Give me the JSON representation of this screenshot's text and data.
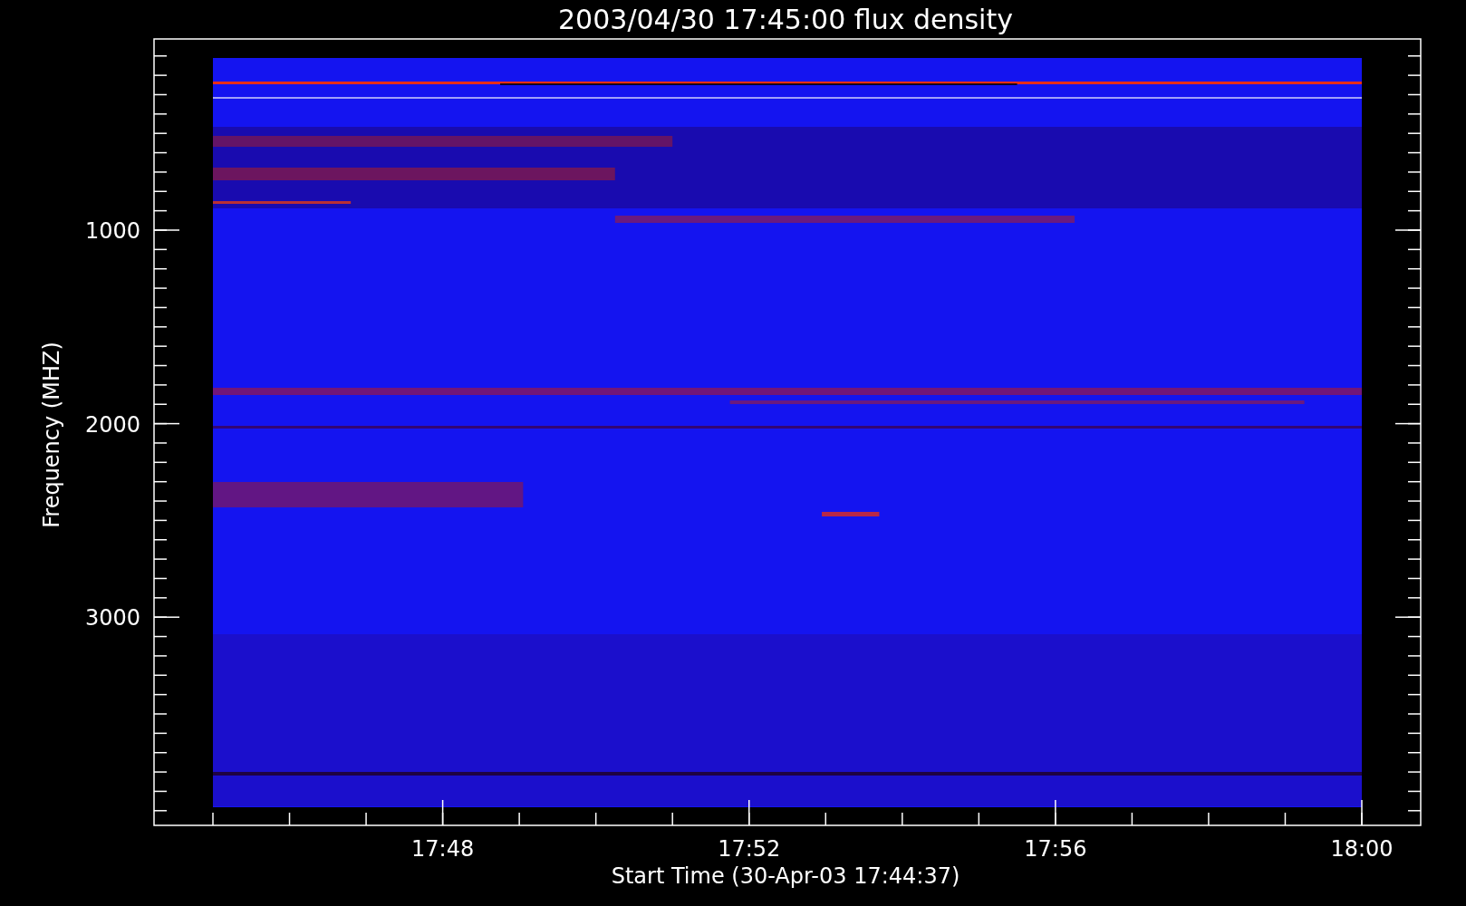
{
  "title": "2003/04/30 17:45:00 flux density",
  "y_axis": {
    "label": "Frequency (MHZ)",
    "ticks": [
      "1000",
      "2000",
      "3000"
    ]
  },
  "x_axis": {
    "label": "Start Time (30-Apr-03 17:44:37)",
    "ticks": [
      "17:48",
      "17:52",
      "17:56",
      "18:00"
    ]
  }
}
